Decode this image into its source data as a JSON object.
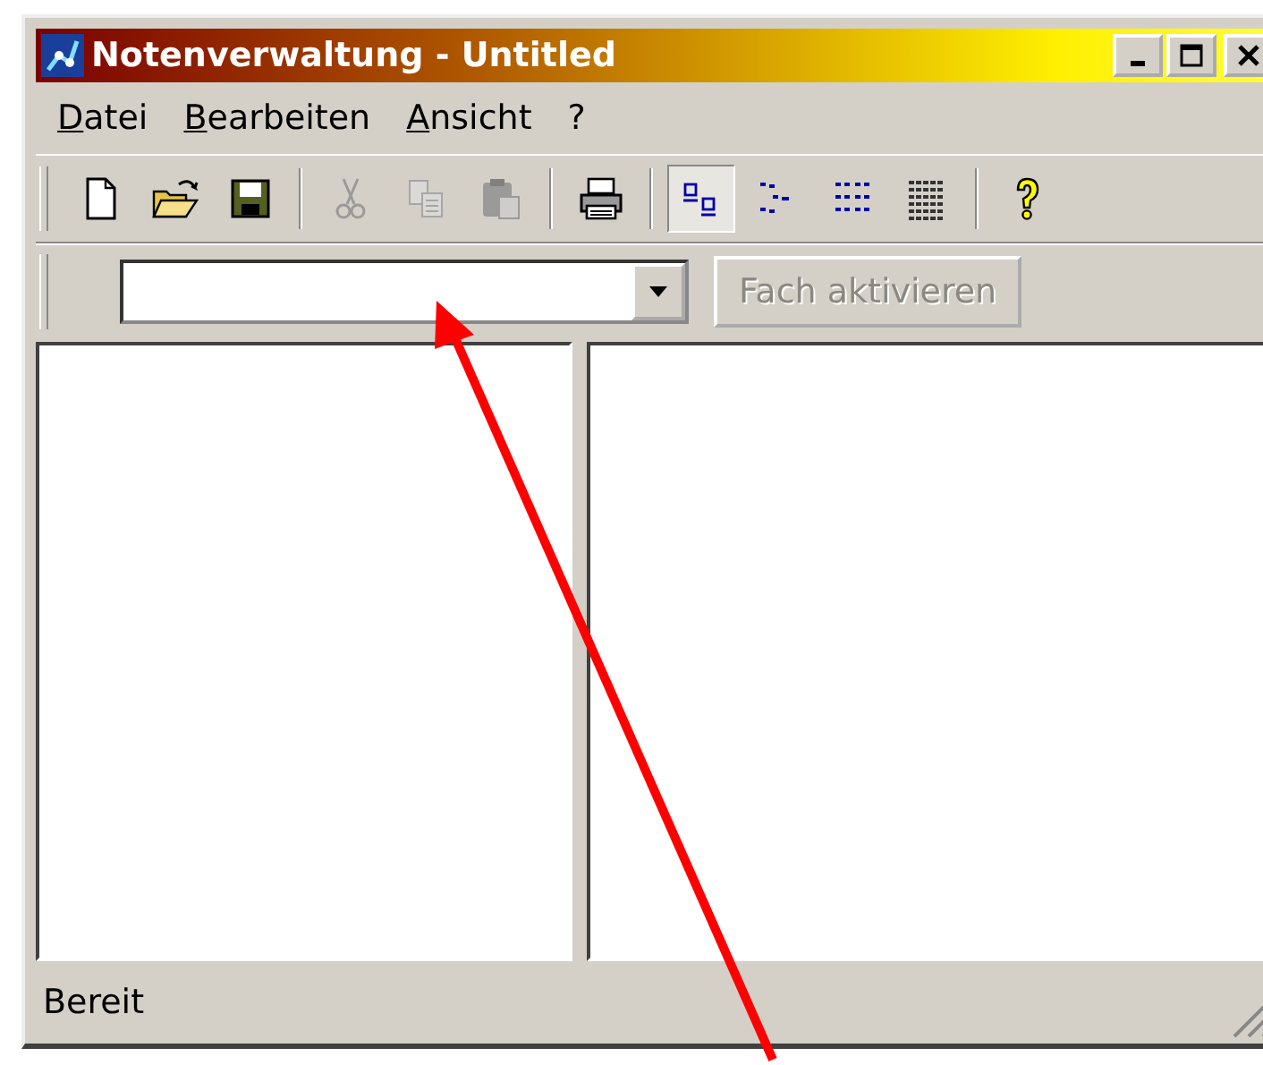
{
  "window": {
    "title": "Notenverwaltung - Untitled"
  },
  "menu": [
    {
      "label": "Datei"
    },
    {
      "label": "Bearbeiten"
    },
    {
      "label": "Ansicht"
    },
    {
      "label": "?"
    }
  ],
  "toolbar": [
    {
      "kind": "button",
      "disabled": false,
      "selected": false
    },
    {
      "kind": "button",
      "disabled": false,
      "selected": false
    },
    {
      "kind": "button",
      "disabled": false,
      "selected": false
    },
    {
      "kind": "separator"
    },
    {
      "kind": "button",
      "disabled": true,
      "selected": false
    },
    {
      "kind": "button",
      "disabled": true,
      "selected": false
    },
    {
      "kind": "button",
      "disabled": true,
      "selected": false
    },
    {
      "kind": "separator"
    },
    {
      "kind": "button",
      "disabled": false,
      "selected": false
    },
    {
      "kind": "separator"
    },
    {
      "kind": "button",
      "disabled": false,
      "selected": true
    },
    {
      "kind": "button",
      "disabled": false,
      "selected": false
    },
    {
      "kind": "button",
      "disabled": false,
      "selected": false
    },
    {
      "kind": "button",
      "disabled": false,
      "selected": false
    },
    {
      "kind": "separator"
    },
    {
      "kind": "button",
      "disabled": false,
      "selected": false
    }
  ],
  "subject_bar": {
    "button": {
      "label": "Fach aktivieren",
      "disabled": true
    }
  },
  "status_bar": {
    "text": "Bereit"
  }
}
